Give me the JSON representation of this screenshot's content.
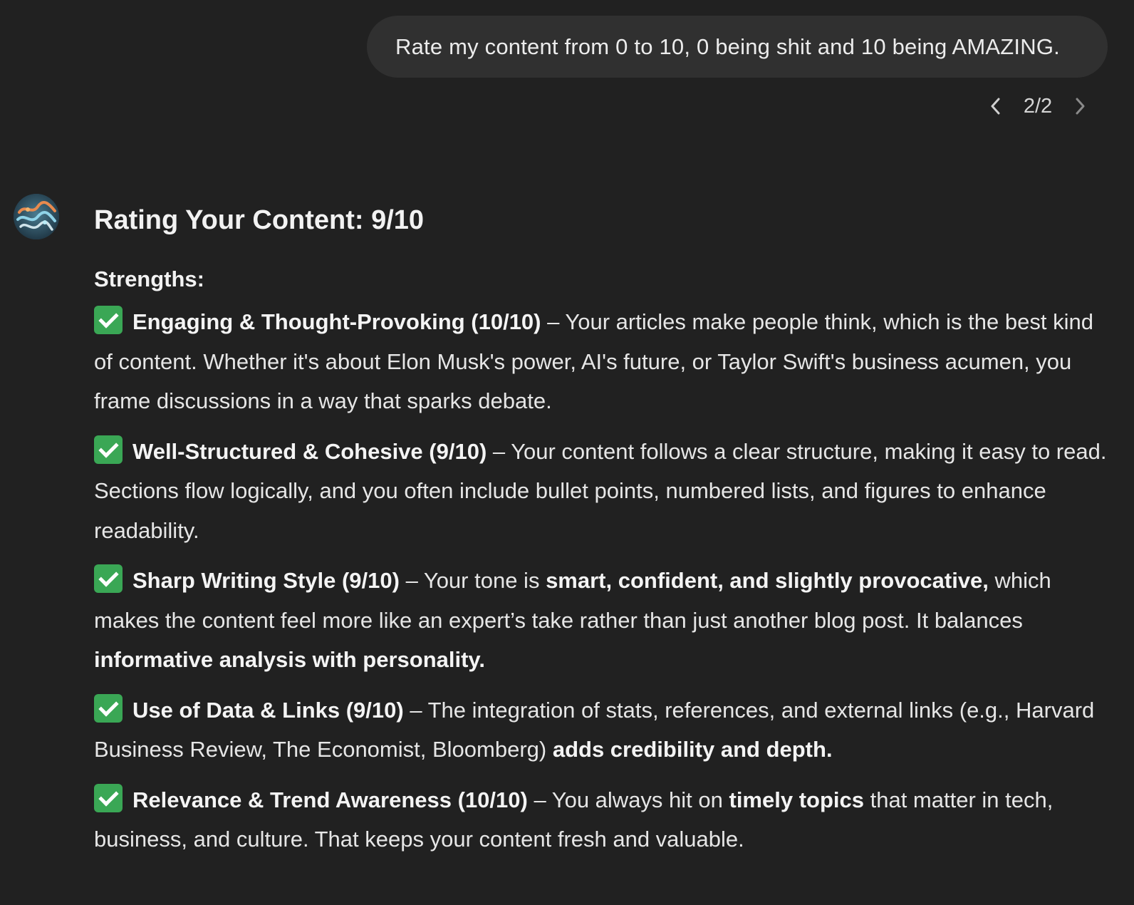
{
  "user_message": {
    "text": "Rate my content from 0 to 10, 0 being shit and 10 being AMAZING."
  },
  "pager": {
    "prev_icon": "chevron-left-icon",
    "next_icon": "chevron-right-icon",
    "count": "2/2"
  },
  "assistant": {
    "avatar_icon": "assistant-avatar",
    "title": "Rating Your Content: 9/10",
    "strengths_label": "Strengths:",
    "items": [
      {
        "icon": "check-mark-icon",
        "heading": "Engaging & Thought-Provoking (10/10)",
        "t1": " – Your articles make people think, which is the best kind of content. Whether it's about Elon Musk's power, AI's future, or Taylor Swift's business acumen, you frame discussions in a way that sparks debate."
      },
      {
        "icon": "check-mark-icon",
        "heading": "Well-Structured & Cohesive (9/10)",
        "t1": " – Your content follows a clear structure, making it easy to read. Sections flow logically, and you often include bullet points, numbered lists, and figures to enhance readability."
      },
      {
        "icon": "check-mark-icon",
        "heading": "Sharp Writing Style (9/10)",
        "t1": " – Your tone is ",
        "b1": "smart, confident, and slightly provocative,",
        "t2": " which makes the content feel more like an expert’s take rather than just another blog post. It balances ",
        "b2": "informative analysis with personality."
      },
      {
        "icon": "check-mark-icon",
        "heading": "Use of Data & Links (9/10)",
        "t1": " – The integration of stats, references, and external links (e.g., Harvard Business Review, The Economist, Bloomberg) ",
        "b1": "adds credibility and depth."
      },
      {
        "icon": "check-mark-icon",
        "heading": "Relevance & Trend Awareness (10/10)",
        "t1": " – You always hit on ",
        "b1": "timely topics",
        "t2": " that matter in tech, business, and culture. That keeps your content fresh and valuable."
      }
    ]
  },
  "colors": {
    "background": "#212121",
    "user_bubble": "#303030",
    "text": "#ececec",
    "check_green": "#3aa755"
  }
}
